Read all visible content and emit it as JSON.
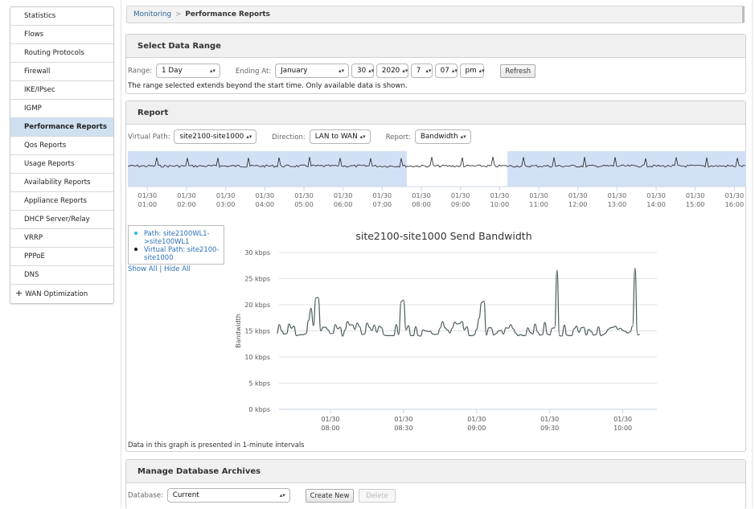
{
  "sidebar": {
    "items": [
      {
        "label": "Statistics",
        "active": false
      },
      {
        "label": "Flows",
        "active": false
      },
      {
        "label": "Routing Protocols",
        "active": false
      },
      {
        "label": "Firewall",
        "active": false
      },
      {
        "label": "IKE/IPsec",
        "active": false
      },
      {
        "label": "IGMP",
        "active": false
      },
      {
        "label": "Performance Reports",
        "active": true
      },
      {
        "label": "Qos Reports",
        "active": false
      },
      {
        "label": "Usage Reports",
        "active": false
      },
      {
        "label": "Availability Reports",
        "active": false
      },
      {
        "label": "Appliance Reports",
        "active": false
      },
      {
        "label": "DHCP Server/Relay",
        "active": false
      },
      {
        "label": "VRRP",
        "active": false
      },
      {
        "label": "PPPoE",
        "active": false
      },
      {
        "label": "DNS",
        "active": false
      }
    ],
    "expandable": {
      "icon": "plus-icon",
      "glyph": "+",
      "label": "WAN Optimization"
    }
  },
  "breadcrumb": {
    "parent": "Monitoring",
    "separator": ">",
    "current": "Performance Reports"
  },
  "data_range": {
    "title": "Select Data Range",
    "range_label": "Range:",
    "range_value": "1 Day",
    "ending_label": "Ending At:",
    "month": "January",
    "day": "30",
    "year": "2020",
    "hour": "7",
    "minute": "07",
    "ampm": "pm",
    "refresh_label": "Refresh",
    "note": "The range selected extends beyond the start time. Only available data is shown."
  },
  "report": {
    "title": "Report",
    "virtual_path_label": "Virtual Path:",
    "virtual_path_value": "site2100-site1000",
    "direction_label": "Direction:",
    "direction_value": "LAN to WAN",
    "report_label": "Report:",
    "report_value": "Bandwidth",
    "legend": [
      {
        "label": "Path: site2100WL1->site100WL1",
        "color": "#2bb5e0"
      },
      {
        "label": "Virtual Path: site2100-site1000",
        "color": "#111111"
      }
    ],
    "show_all": "Show All",
    "hide_all": "Hide All",
    "show_hide_sep": "|",
    "footnote": "Data in this graph is presented in 1-minute intervals"
  },
  "archives": {
    "title": "Manage Database Archives",
    "database_label": "Database:",
    "database_value": "Current",
    "create_label": "Create New",
    "delete_label": "Delete"
  },
  "chart_data": [
    {
      "type": "line",
      "title": "",
      "role": "overview-navigator",
      "x_tick_labels": [
        [
          "01/30",
          "01:00"
        ],
        [
          "01/30",
          "02:00"
        ],
        [
          "01/30",
          "03:00"
        ],
        [
          "01/30",
          "04:00"
        ],
        [
          "01/30",
          "05:00"
        ],
        [
          "01/30",
          "06:00"
        ],
        [
          "01/30",
          "07:00"
        ],
        [
          "01/30",
          "08:00"
        ],
        [
          "01/30",
          "09:00"
        ],
        [
          "01/30",
          "10:00"
        ],
        [
          "01/30",
          "11:00"
        ],
        [
          "01/30",
          "12:00"
        ],
        [
          "01/30",
          "13:00"
        ],
        [
          "01/30",
          "14:00"
        ],
        [
          "01/30",
          "15:00"
        ],
        [
          "01/30",
          "16:00"
        ]
      ],
      "x_range_hours": [
        0.5,
        16.3
      ],
      "selected_window_hours": [
        7.63,
        10.2
      ],
      "shaded_outside_selection": true,
      "color_line": "#222222",
      "color_shade": "#d2e0f6"
    },
    {
      "type": "line",
      "title": "site2100-site1000 Send Bandwidth",
      "xlabel": "",
      "ylabel": "Bandwidth",
      "y_tick_labels": [
        "0 kbps",
        "5 kbps",
        "10 kbps",
        "15 kbps",
        "20 kbps",
        "25 kbps",
        "30 kbps"
      ],
      "ylim": [
        0,
        30
      ],
      "y_unit": "kbps",
      "x_tick_labels": [
        [
          "01/30",
          "08:00"
        ],
        [
          "01/30",
          "08:30"
        ],
        [
          "01/30",
          "09:00"
        ],
        [
          "01/30",
          "09:30"
        ],
        [
          "01/30",
          "10:00"
        ]
      ],
      "x_start": "07:38",
      "x_interval_minutes": 1,
      "grid": true,
      "color_line": "#4a5a5c",
      "series": [
        {
          "name": "Virtual Path: site2100-site1000",
          "values": [
            14.5,
            16.2,
            15.0,
            14.4,
            14.5,
            16.3,
            15.5,
            15.9,
            14.1,
            14.2,
            14.3,
            14.3,
            14.5,
            17.0,
            19.3,
            16.0,
            21.3,
            21.4,
            15.0,
            15.7,
            15.7,
            15.2,
            14.5,
            14.5,
            16.2,
            15.4,
            15.7,
            14.0,
            15.2,
            16.8,
            16.1,
            16.2,
            15.3,
            16.5,
            15.8,
            14.3,
            14.4,
            16.5,
            15.7,
            15.1,
            16.1,
            14.7,
            15.9,
            15.6,
            14.2,
            14.1,
            14.1,
            14.1,
            14.1,
            16.2,
            14.3,
            20.6,
            20.9,
            15.2,
            16.0,
            14.1,
            14.1,
            15.8,
            14.1,
            14.0,
            15.2,
            15.0,
            14.9,
            14.9,
            14.4,
            14.3,
            14.4,
            15.5,
            16.8,
            15.6,
            15.2,
            14.6,
            15.5,
            16.7,
            16.3,
            16.4,
            16.8,
            15.2,
            15.8,
            14.1,
            14.1,
            14.2,
            15.3,
            17.4,
            20.4,
            20.7,
            14.2,
            15.6,
            15.6,
            14.2,
            14.5,
            15.0,
            15.1,
            14.4,
            15.6,
            15.5,
            16.2,
            15.4,
            14.6,
            14.1,
            14.3,
            14.1,
            14.1,
            15.6,
            14.7,
            14.4,
            16.3,
            14.8,
            14.2,
            14.3,
            16.6,
            14.4,
            14.2,
            15.5,
            15.6,
            26.6,
            14.1,
            14.0,
            16.1,
            14.2,
            14.1,
            14.1,
            15.4,
            15.9,
            14.7,
            15.6,
            15.7,
            14.2,
            15.3,
            14.9,
            14.2,
            14.3,
            15.8,
            14.1,
            14.3,
            14.6,
            15.3,
            15.6,
            15.7,
            15.9,
            15.3,
            15.5,
            15.1,
            14.9,
            14.6,
            14.8,
            15.9,
            27.0,
            14.3,
            14.3
          ]
        }
      ]
    }
  ]
}
